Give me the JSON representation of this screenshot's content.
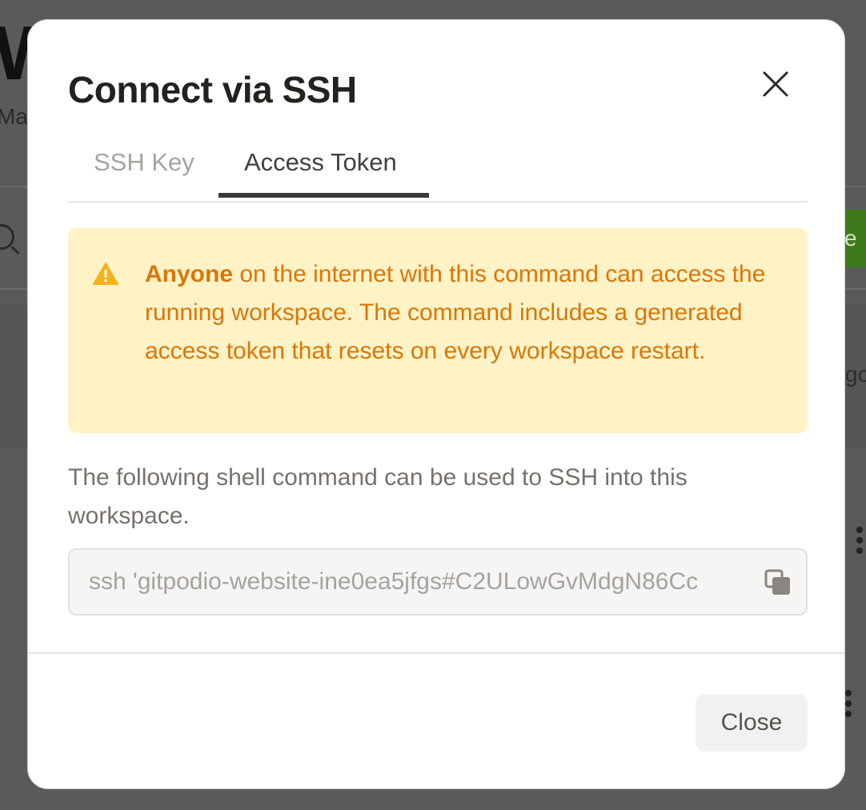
{
  "background": {
    "title_fragment": "W",
    "subtitle_fragment": "Ma",
    "button_fragment": "e",
    "side_fragment": "go"
  },
  "modal": {
    "title": "Connect via SSH",
    "tabs": [
      {
        "label": "SSH Key",
        "active": false
      },
      {
        "label": "Access Token",
        "active": true
      }
    ],
    "warning": {
      "bold": "Anyone",
      "text": " on the internet with this command can access the running workspace. The command includes a generated access token that resets on every workspace restart."
    },
    "description": "The following shell command can be used to SSH into this workspace.",
    "command_value": "ssh 'gitpodio-website-ine0ea5jfgs#C2ULowGvMdgN86Cc",
    "close_label": "Close"
  },
  "colors": {
    "warning_bg": "#fef2c7",
    "warning_text": "#d97706",
    "accent_green": "#3f7a1a"
  },
  "icons": [
    "close-icon",
    "warning-icon",
    "copy-icon",
    "search-icon",
    "more-vertical-icon"
  ]
}
